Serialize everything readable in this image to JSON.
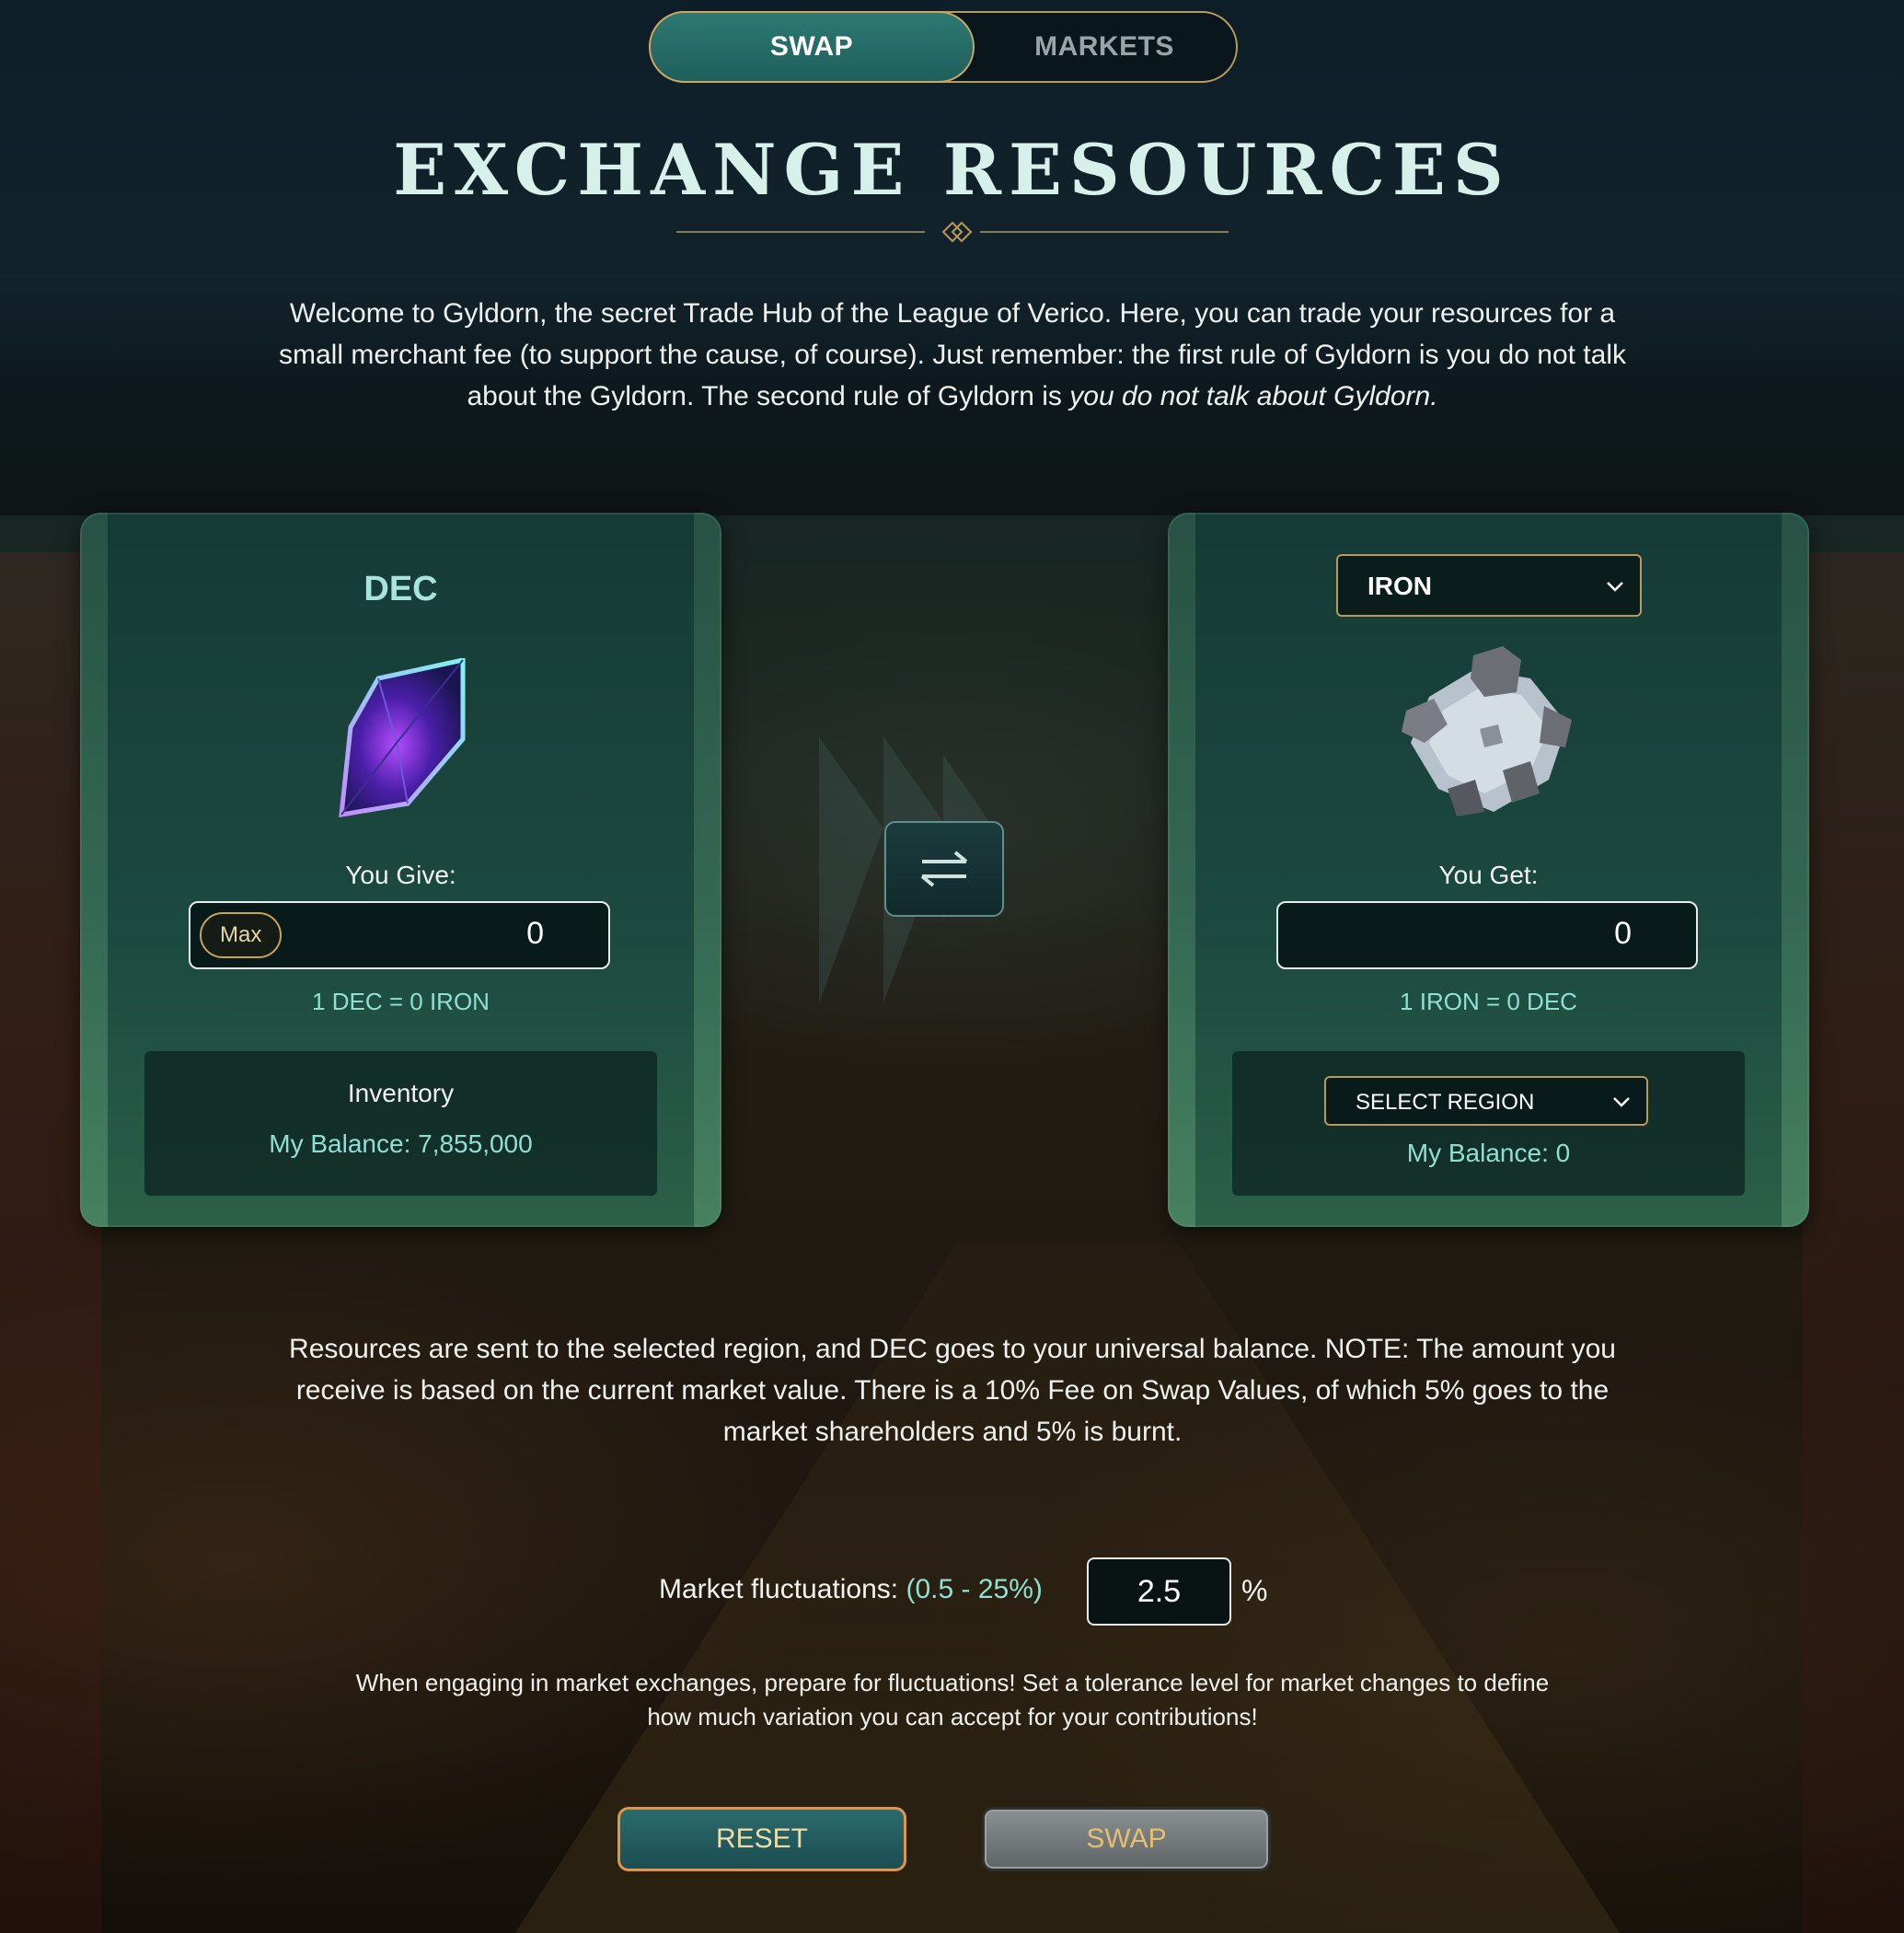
{
  "tabs": [
    {
      "label": "SWAP",
      "active": true
    },
    {
      "label": "MARKETS",
      "active": false
    }
  ],
  "title": "EXCHANGE RESOURCES",
  "intro": {
    "text": "Welcome to Gyldorn, the secret Trade Hub of the League of Verico. Here, you can trade your resources for a small merchant fee (to support the cause, of course). Just remember: the first rule of Gyldorn is you do not talk about the Gyldorn. The second rule of Gyldorn is ",
    "emphasis": "you do not talk about Gyldorn."
  },
  "give_panel": {
    "resource": "DEC",
    "icon": "dec-crystal-icon",
    "label": "You Give:",
    "max_label": "Max",
    "amount": "0",
    "rate": "1 DEC = 0 IRON",
    "inventory_label": "Inventory",
    "balance": "My Balance: 7,855,000"
  },
  "get_panel": {
    "resource_selected": "IRON",
    "icon": "iron-ore-icon",
    "label": "You Get:",
    "amount": "0",
    "rate": "1 IRON = 0 DEC",
    "region_selected": "SELECT REGION",
    "balance": "My Balance: 0"
  },
  "note": "Resources are sent to the selected region, and DEC goes to your universal balance. NOTE: The amount you receive is based on the current market value. There is a 10% Fee on Swap Values, of which 5% goes to the market shareholders and 5% is burnt.",
  "fluctuation": {
    "label": "Market fluctuations:",
    "range": "(0.5 - 25%)",
    "value": "2.5",
    "unit": "%",
    "help": "When engaging in market exchanges, prepare for fluctuations! Set a tolerance level for market changes to define how much variation you can accept for your contributions!"
  },
  "buttons": {
    "reset": "RESET",
    "swap": "SWAP"
  },
  "colors": {
    "accent_teal": "#8fe0d2",
    "gold_border": "#b89a5a",
    "reset_border": "#e0964a"
  }
}
